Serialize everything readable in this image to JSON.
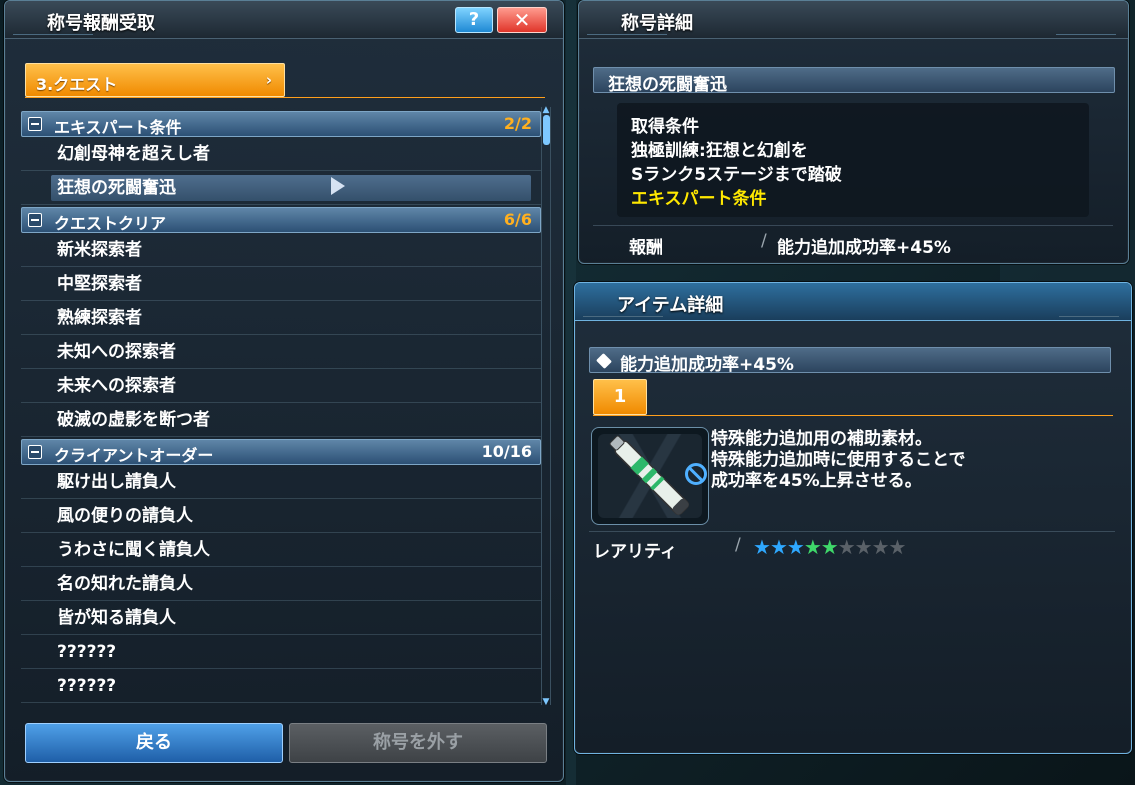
{
  "left_panel": {
    "title": "称号報酬受取",
    "help_label": "?",
    "close_label": "✕",
    "category_tab": {
      "label": "3.クエスト",
      "chevron": "›"
    },
    "groups": [
      {
        "title": "エキスパート条件",
        "count": "2/2",
        "count_color": "orange",
        "items": [
          "幻創母神を超えし者",
          "狂想の死闘奮迅"
        ]
      },
      {
        "title": "クエストクリア",
        "count": "6/6",
        "count_color": "orange",
        "items": [
          "新米探索者",
          "中堅探索者",
          "熟練探索者",
          "未知への探索者",
          "未来への探索者",
          "破滅の虚影を断つ者"
        ]
      },
      {
        "title": "クライアントオーダー",
        "count": "10/16",
        "count_color": "white",
        "items": [
          "駆け出し請負人",
          "風の便りの請負人",
          "うわさに聞く請負人",
          "名の知れた請負人",
          "皆が知る請負人",
          "??????",
          "??????"
        ]
      }
    ],
    "selected_item": "狂想の死闘奮迅",
    "back_button": "戻る",
    "remove_button": "称号を外す"
  },
  "title_detail": {
    "title": "称号詳細",
    "name": "狂想の死闘奮迅",
    "condition_lines": [
      "取得条件",
      "独極訓練:狂想と幻創を",
      "Sランク5ステージまで踏破"
    ],
    "condition_type": "エキスパート条件",
    "reward_label": "報酬",
    "reward_value": "能力追加成功率+45%"
  },
  "item_detail": {
    "title": "アイテム詳細",
    "name": "能力追加成功率+45%",
    "quantity": "1",
    "description_lines": [
      "特殊能力追加用の補助素材。",
      "特殊能力追加時に使用することで",
      "成功率を45%上昇させる。"
    ],
    "rarity_label": "レアリティ",
    "rarity": {
      "value": 5,
      "max": 9
    }
  },
  "colors": {
    "accent_orange": "#f08a00",
    "count_orange": "#ffb020",
    "condition_yellow": "#ffe800",
    "star_tier1": "#2ea8ff",
    "star_tier2": "#3fd86a",
    "star_empty": "#5a6168"
  },
  "icons": [
    "help-icon",
    "close-icon",
    "collapse-icon",
    "cursor-icon",
    "item-icon",
    "no-trade-icon",
    "star-icon"
  ]
}
